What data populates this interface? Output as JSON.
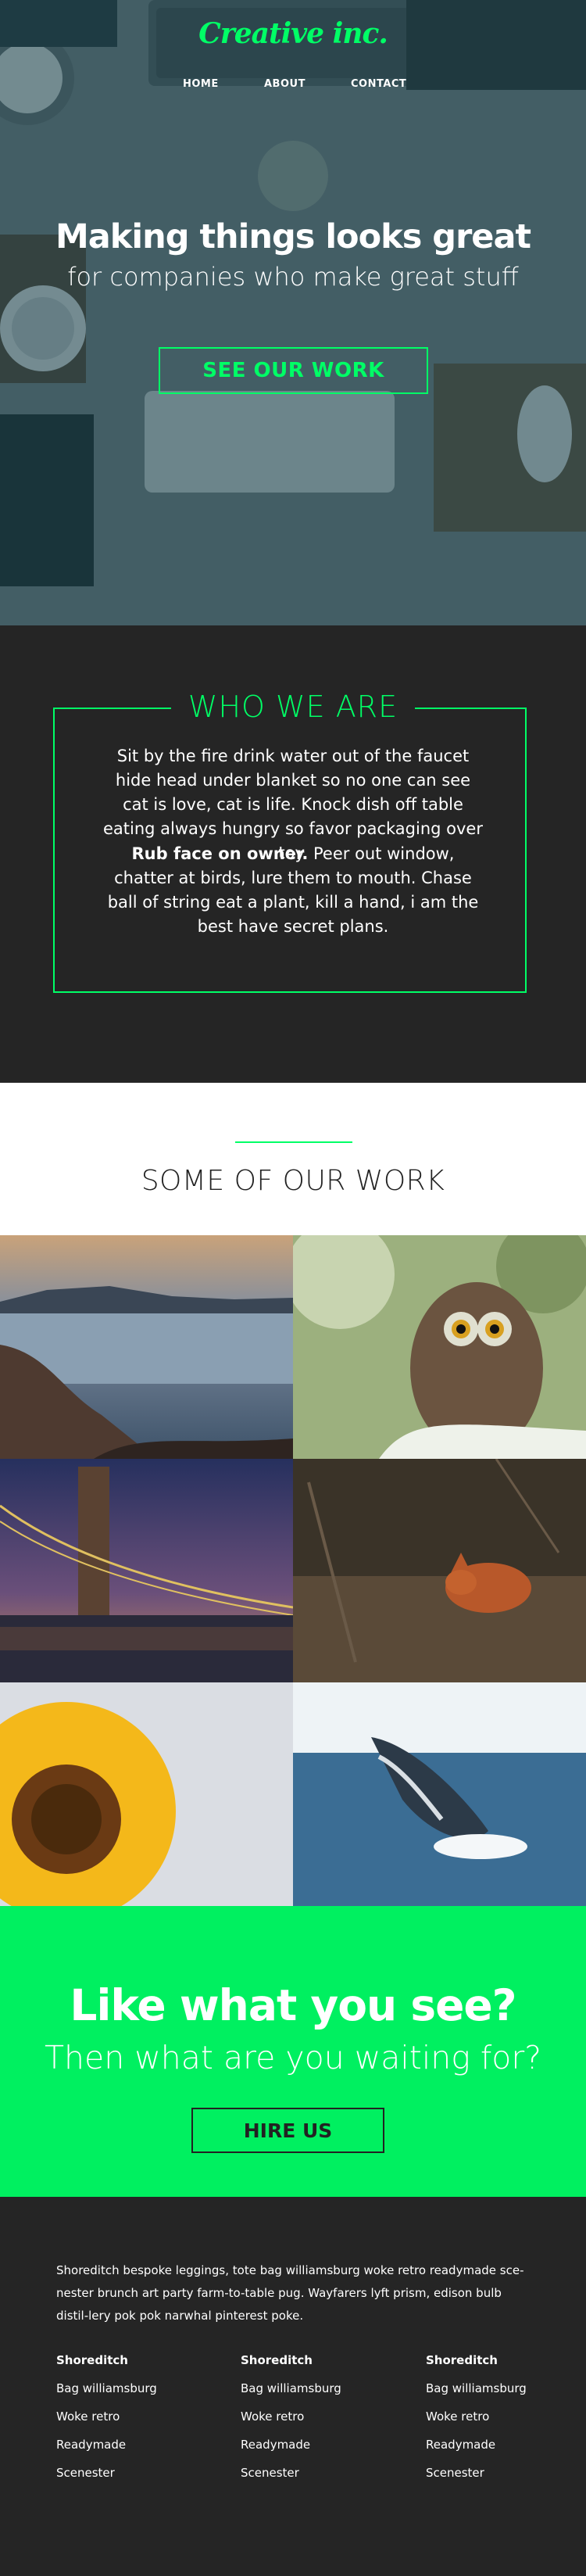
{
  "header": {
    "logo": "Creative inc.",
    "nav": [
      "HOME",
      "ABOUT",
      "CONTACT"
    ]
  },
  "hero": {
    "headline": "Making things looks great",
    "subhead": "for companies who make great stuff",
    "cta": "SEE OUR WORK"
  },
  "who": {
    "title": "WHO WE ARE",
    "p1": "Sit by the fire drink water out of the faucet hide head under blanket so no one can see cat is love, cat is life. Knock dish off table eating always hungry so favor packaging over toy.",
    "p2_bold": "Rub face on owner.",
    "p2_rest": " Peer out window, chatter at birds, lure them to mouth. Chase ball of string eat a plant, kill a hand, i am the best have secret plans."
  },
  "work": {
    "title": "SOME OF OUR WORK",
    "tiles": [
      "coast-photo",
      "owl-photo",
      "bridge-photo",
      "fox-photo",
      "sunflower-photo",
      "whale-photo"
    ]
  },
  "hire": {
    "title": "Like what you see?",
    "subtitle": "Then what are you waiting for?",
    "button": "HIRE US"
  },
  "footer": {
    "text": "Shoreditch bespoke leggings, tote bag williamsburg woke retro readymade sce-nester brunch art party farm-to-table pug. Wayfarers lyft prism, edison bulb distil-lery pok pok narwhal pinterest poke.",
    "columns": [
      {
        "heading": "Shoreditch",
        "items": [
          "Bag williamsburg",
          "Woke retro",
          "Readymade",
          "Scenester"
        ]
      },
      {
        "heading": "Shoreditch",
        "items": [
          "Bag williamsburg",
          "Woke retro",
          "Readymade",
          "Scenester"
        ]
      },
      {
        "heading": "Shoreditch",
        "items": [
          "Bag williamsburg",
          "Woke retro",
          "Readymade",
          "Scenester"
        ]
      }
    ]
  },
  "colors": {
    "accent": "#00ff66",
    "dark": "#252525",
    "hire_bg": "#00f060"
  }
}
